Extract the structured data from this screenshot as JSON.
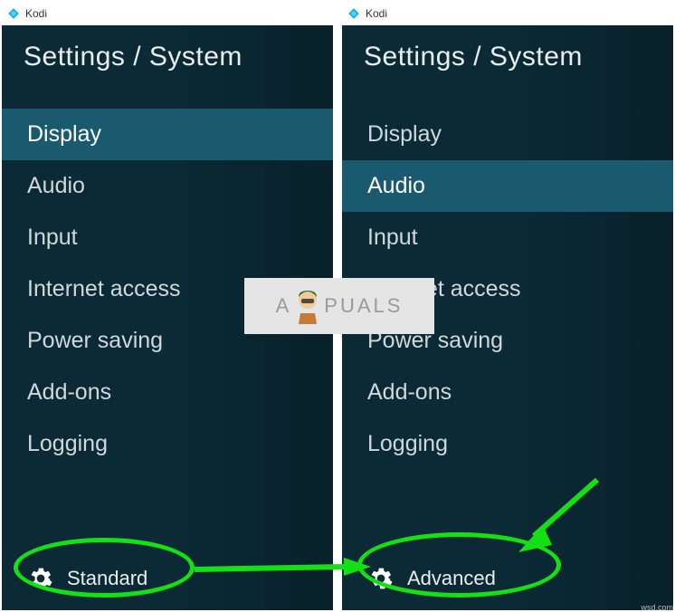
{
  "left": {
    "titlebar": {
      "app_name": "Kodi"
    },
    "breadcrumb": "Settings / System",
    "menu": [
      {
        "label": "Display",
        "selected": true
      },
      {
        "label": "Audio",
        "selected": false
      },
      {
        "label": "Input",
        "selected": false
      },
      {
        "label": "Internet access",
        "selected": false
      },
      {
        "label": "Power saving",
        "selected": false
      },
      {
        "label": "Add-ons",
        "selected": false
      },
      {
        "label": "Logging",
        "selected": false
      }
    ],
    "level_label": "Standard"
  },
  "right": {
    "titlebar": {
      "app_name": "Kodi"
    },
    "breadcrumb": "Settings / System",
    "menu": [
      {
        "label": "Display",
        "selected": false
      },
      {
        "label": "Audio",
        "selected": true
      },
      {
        "label": "Input",
        "selected": false
      },
      {
        "label": "Internet access",
        "selected": false
      },
      {
        "label": "Power saving",
        "selected": false
      },
      {
        "label": "Add-ons",
        "selected": false
      },
      {
        "label": "Logging",
        "selected": false
      }
    ],
    "level_label": "Advanced"
  },
  "watermark_text_left": "A",
  "watermark_text_right": "PUALS",
  "source_caption": "wsd.com",
  "colors": {
    "menu_bg": "#0b2a35",
    "menu_selected": "#1a5a6e",
    "annotation": "#15e015"
  }
}
